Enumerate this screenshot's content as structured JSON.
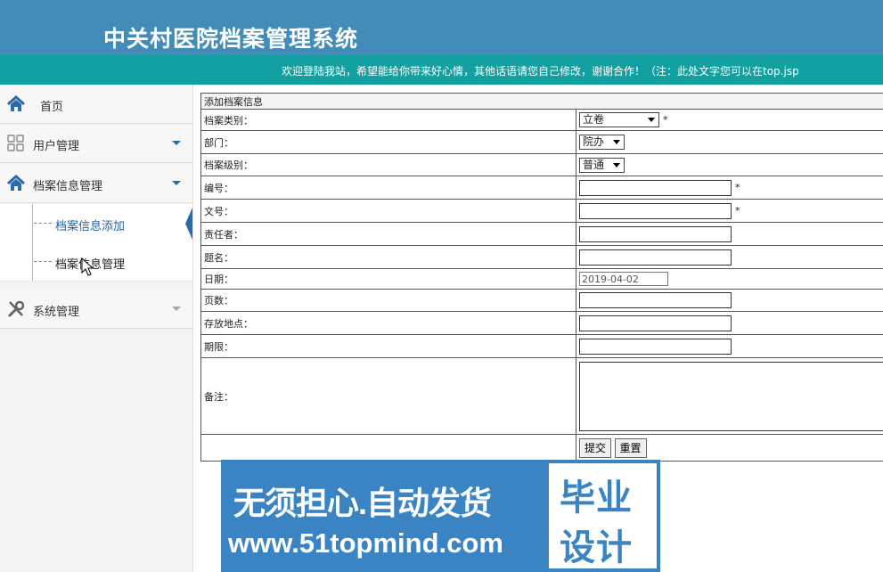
{
  "header": {
    "title": "中关村医院档案管理系统"
  },
  "marquee": {
    "text": "欢迎登陆我站，希望能给你带来好心情，其他话语请您自己修改，谢谢合作！（注：此处文字您可以在top.jsp"
  },
  "sidebar": {
    "home": {
      "label": "首页",
      "icon": "home-icon"
    },
    "user_mgmt": {
      "label": "用户管理",
      "icon": "grid-icon"
    },
    "archive_mgmt": {
      "label": "档案信息管理",
      "icon": "home-icon"
    },
    "archive_sub": [
      {
        "label": "档案信息添加",
        "active": true
      },
      {
        "label": "档案信息管理",
        "active": false
      }
    ],
    "system_mgmt": {
      "label": "系统管理",
      "icon": "tools-icon"
    }
  },
  "form": {
    "caption": "添加档案信息",
    "category": {
      "label": "档案类别：",
      "value": "立卷",
      "required": "*"
    },
    "department": {
      "label": "部门：",
      "value": "院办"
    },
    "level": {
      "label": "档案级别：",
      "value": "普通"
    },
    "number": {
      "label": "编号：",
      "value": "",
      "required": "*"
    },
    "doc_number": {
      "label": "文号：",
      "value": "",
      "required": "*"
    },
    "responsible": {
      "label": "责任者：",
      "value": ""
    },
    "title": {
      "label": "题名：",
      "value": ""
    },
    "date": {
      "label": "日期：",
      "value": "2019-04-02"
    },
    "pages": {
      "label": "页数：",
      "value": ""
    },
    "location": {
      "label": "存放地点：",
      "value": ""
    },
    "term": {
      "label": "期限：",
      "value": ""
    },
    "remarks": {
      "label": "备注：",
      "value": ""
    },
    "submit_label": "提交",
    "reset_label": "重置"
  },
  "watermark": {
    "line1": "无须担心.自动发货",
    "line2": "www.51topmind.com",
    "box_line1": "毕业",
    "box_line2": "设计"
  },
  "colors": {
    "header": "#448cb8",
    "marquee": "#12a0a0",
    "accent": "#2a6aa8",
    "banner": "#3a84c4"
  }
}
